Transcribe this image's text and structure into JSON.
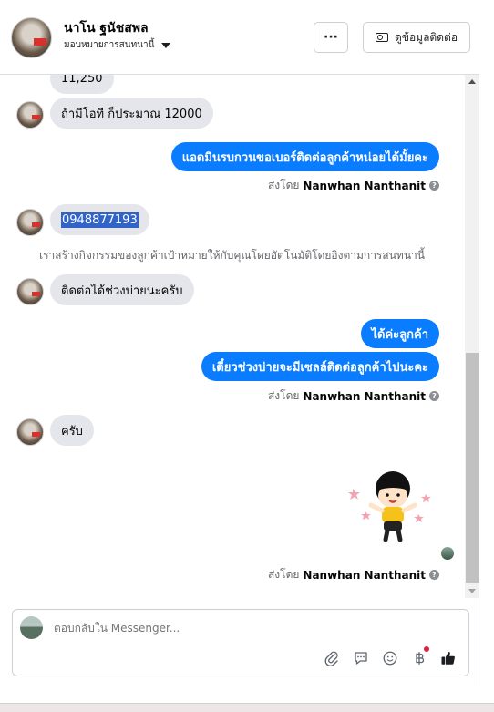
{
  "header": {
    "name": "นาโน ฐนัชสพล",
    "subtitle": "มอบหมายการสนทนานี้",
    "more_label": "···",
    "contact_label": "ดูข้อมูลติดต่อ"
  },
  "messages": {
    "m1": "11,250",
    "m2": "ถ้ามีโอที ก็ประมาณ 12000",
    "m3": "แอดมินรบกวนขอเบอร์ติดต่อลูกค้าหน่อยได้มั้ยคะ",
    "m4": "0948877193",
    "system": "เราสร้างกิจกรรมของลูกค้าเป้าหมายให้กับคุณโดยอัตโนมัติโดยอิงตามการสนทนานี้",
    "m5": "ติดต่อได้ช่วงบ่ายนะครับ",
    "m6": "ได้ค่ะลูกค้า",
    "m7": "เดี๋ยวช่วงบ่ายจะมีเซลล์ติดต่อลูกค้าไปนะคะ",
    "m8": "ครับ"
  },
  "sent_by": {
    "prefix": "ส่งโดย",
    "name": "Nanwhan Nanthanit"
  },
  "composer": {
    "placeholder": "ตอบกลับใน Messenger..."
  },
  "icons": [
    "more-icon",
    "contact-card-icon",
    "info-icon",
    "attach-icon",
    "saved-reply-icon",
    "emoji-icon",
    "baht-icon",
    "thumbs-up-icon"
  ],
  "colors": {
    "outgoing": "#0a7cff",
    "incoming": "#e4e6eb",
    "accent_blue": "#1877f2"
  }
}
